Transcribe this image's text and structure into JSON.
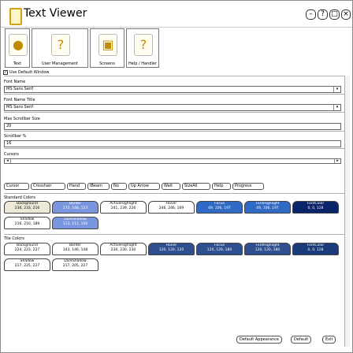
{
  "window": {
    "title": "Text Viewer",
    "buttons": [
      "–",
      "?",
      "□",
      "×"
    ]
  },
  "toolbar": [
    {
      "label": "Text",
      "icon": "●"
    },
    {
      "label": "User Management",
      "icon": "?"
    },
    {
      "label": "Screens",
      "icon": "▣"
    },
    {
      "label": "Help / Handler",
      "icon": "?"
    }
  ],
  "filters": {
    "checkbox_label": "Use Default Window",
    "checked": true
  },
  "settings": {
    "font_name_label": "Font Name",
    "font_name_value": "MS Sans Serif",
    "font_name_title_label": "Font Name Title",
    "font_name_title_value": "MS Sans Serif",
    "scrollbar_size_label": "Max Scrollbar Size",
    "scrollbar_size_value": "20",
    "scrollbar_pct_label": "Scrollbar %",
    "scrollbar_pct_value": "16",
    "cursors_label": "Cursors"
  },
  "cursor_chips": [
    "Cursor",
    "Crosshair",
    "Hand",
    "IBeam",
    "No",
    "Up Arrow",
    "Wait",
    "SizeAll",
    "Help",
    "Progress"
  ],
  "standard_colors_label": "Standard Colors",
  "standard_swatches": [
    {
      "name": "Background",
      "value": "236, 233, 216",
      "bg": "#ece9d8",
      "dark": false
    },
    {
      "name": "Border",
      "value": "172, 168, 153",
      "bg": "#7a96df",
      "dark": true
    },
    {
      "name": "ActiveHighlight",
      "value": "241, 239, 226",
      "bg": "#ffffff",
      "dark": false
    },
    {
      "name": "Hover",
      "value": "246, 246, 169",
      "bg": "#ffffff",
      "dark": false
    },
    {
      "name": "Focus",
      "value": "49, 106, 197",
      "bg": "#316ac5",
      "dark": true
    },
    {
      "name": "FontHighlight",
      "value": "49, 106, 197",
      "bg": "#316ac5",
      "dark": true
    },
    {
      "name": "FontColor",
      "value": "0, 0, 128",
      "bg": "#0a246a",
      "dark": true
    },
    {
      "name": "Shadow",
      "value": "216, 210, 189",
      "bg": "#ffffff",
      "dark": false
    },
    {
      "name": "DarkShadow",
      "value": "113, 111, 100",
      "bg": "#7a96df",
      "dark": true
    }
  ],
  "tile_colors_label": "Tile Colors",
  "tile_swatches": [
    {
      "name": "Background",
      "value": "224, 223, 227",
      "bg": "#ffffff",
      "dark": false
    },
    {
      "name": "Border",
      "value": "143, 146, 148",
      "bg": "#ffffff",
      "dark": false
    },
    {
      "name": "ActiveHighlight",
      "value": "230, 230, 230",
      "bg": "#ffffff",
      "dark": false
    },
    {
      "name": "Hover",
      "value": "120, 120, 120",
      "bg": "#2f4f8f",
      "dark": true
    },
    {
      "name": "Focus",
      "value": "120, 120, 180",
      "bg": "#2f4f8f",
      "dark": true
    },
    {
      "name": "FontHighlight",
      "value": "120, 120, 180",
      "bg": "#2f4f8f",
      "dark": true
    },
    {
      "name": "FontColor",
      "value": "0, 0, 128",
      "bg": "#1a3a7a",
      "dark": true
    },
    {
      "name": "Shadow",
      "value": "217, 225, 227",
      "bg": "#ffffff",
      "dark": false
    },
    {
      "name": "DarkShadow",
      "value": "217, 205, 227",
      "bg": "#ffffff",
      "dark": false
    }
  ],
  "bottom_buttons": {
    "default_appearance": "Default Appearance",
    "default": "Default",
    "exit": "Exit"
  }
}
